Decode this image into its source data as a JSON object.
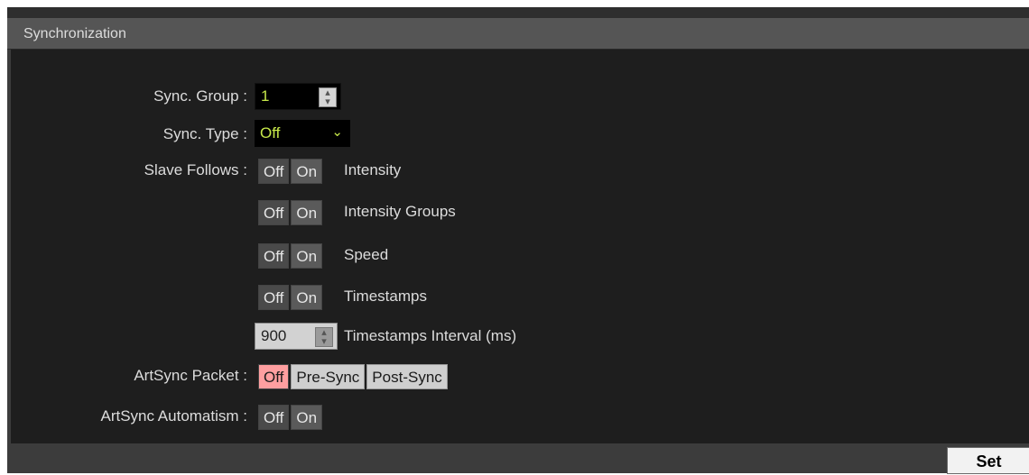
{
  "window": {
    "title": "Synchronization"
  },
  "fields": {
    "sync_group": {
      "label": "Sync. Group :",
      "value": "1"
    },
    "sync_type": {
      "label": "Sync. Type :",
      "value": "Off"
    },
    "slave_follows": {
      "label": "Slave Follows :",
      "options": [
        {
          "name": "Intensity",
          "off": "Off",
          "on": "On"
        },
        {
          "name": "Intensity Groups",
          "off": "Off",
          "on": "On"
        },
        {
          "name": "Speed",
          "off": "Off",
          "on": "On"
        },
        {
          "name": "Timestamps",
          "off": "Off",
          "on": "On"
        }
      ],
      "interval": {
        "value": "900",
        "label": "Timestamps Interval (ms)"
      }
    },
    "artsync_packet": {
      "label": "ArtSync Packet :",
      "options": [
        "Off",
        "Pre-Sync",
        "Post-Sync"
      ],
      "selected": "Off"
    },
    "artsync_automatism": {
      "label": "ArtSync Automatism :",
      "off": "Off",
      "on": "On"
    }
  },
  "footer": {
    "set_label": "Set"
  },
  "colors": {
    "accent_value": "#c7e84a",
    "selected_off": "#ff9fa0"
  }
}
